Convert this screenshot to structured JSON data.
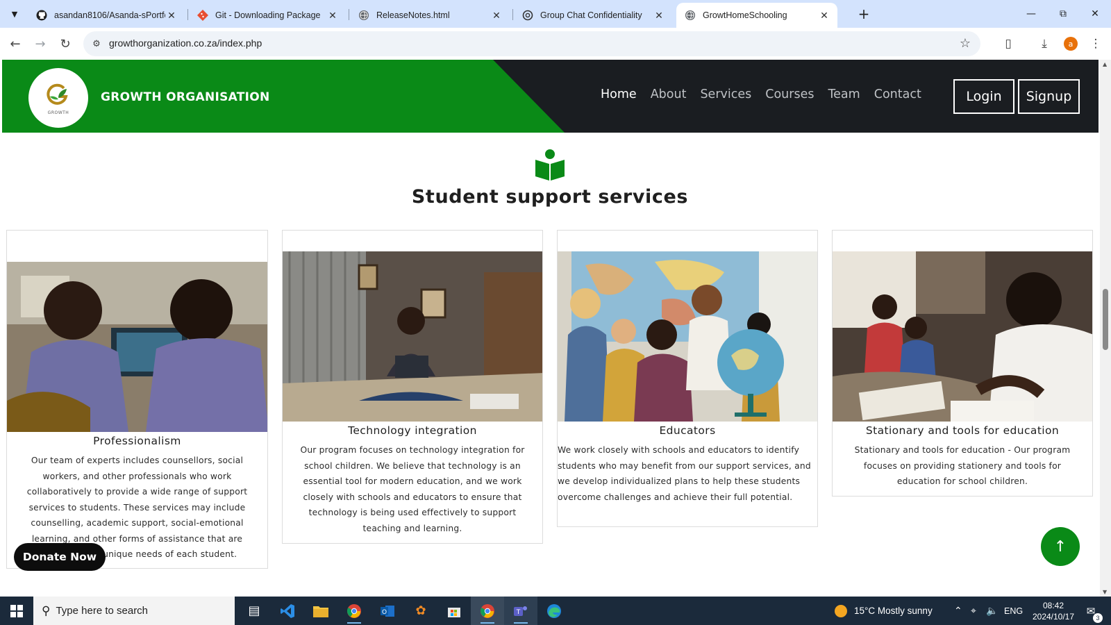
{
  "browser": {
    "tabs": [
      {
        "title": "asandan8106/Asanda-sPortfolio",
        "icon": "github-icon"
      },
      {
        "title": "Git - Downloading Package",
        "icon": "git-icon"
      },
      {
        "title": "ReleaseNotes.html",
        "icon": "globe-icon"
      },
      {
        "title": "Group Chat Confidentiality",
        "icon": "chatgpt-icon"
      },
      {
        "title": "GrowtHomeSchooling",
        "icon": "globe-icon",
        "active": true
      }
    ],
    "url": "growthorganization.co.za/index.php",
    "profile_initial": "a"
  },
  "site": {
    "brand": "GROWTH ORGANISATION",
    "logo_text": "GROWTH",
    "nav": [
      "Home",
      "About",
      "Services",
      "Courses",
      "Team",
      "Contact"
    ],
    "login": "Login",
    "signup": "Signup",
    "colors": {
      "primary_green": "#0a8a17",
      "header_dark": "#1a1d21"
    }
  },
  "section": {
    "icon": "reader-book-icon",
    "title": "Student support services"
  },
  "cards": [
    {
      "title": "Professionalism",
      "image": "two students at a computer",
      "text": "Our team of experts includes counsellors, social workers, and other professionals who work collaboratively to provide a wide range of support services to students. These services may include counselling, academic support, social-emotional learning, and other forms of assistance that are tailored to the unique needs of each student."
    },
    {
      "title": "Technology integration",
      "image": "student with laptop on bed",
      "text": "Our program focuses on technology integration for school children. We believe that technology is an essential tool for modern education, and we work closely with schools and educators to ensure that technology is being used effectively to support teaching and learning."
    },
    {
      "title": "Educators",
      "image": "teacher with children and a globe",
      "text": "We work closely with schools and educators to identify students who may benefit from our support services, and we develop individualized plans to help these students overcome challenges and achieve their full potential."
    },
    {
      "title": "Stationary and tools for education",
      "image": "student writing at a table",
      "text": "Stationary and tools for education - Our program focuses on providing stationery and tools for education for school children."
    }
  ],
  "donate": "Donate Now",
  "taskbar": {
    "search_placeholder": "Type here to search",
    "weather": "15°C  Mostly sunny",
    "language": "ENG",
    "time": "08:42",
    "date": "2024/10/17",
    "notifications": "3"
  }
}
